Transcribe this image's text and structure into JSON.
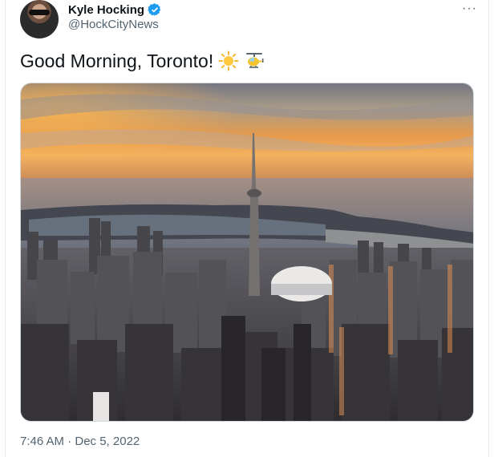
{
  "author": {
    "name": "Kyle Hocking",
    "handle": "@HockCityNews",
    "verified_icon": "verified-badge-icon"
  },
  "more_menu": {
    "label": "···",
    "icon": "more-icon"
  },
  "tweet": {
    "text": "Good Morning, Toronto!",
    "emojis": [
      "sun-icon",
      "helicopter-icon"
    ]
  },
  "media": {
    "icon": "photo-toronto-skyline-sunrise"
  },
  "footer": {
    "timestamp": "7:46 AM · Dec 5, 2022"
  },
  "colors": {
    "text": "#0f1419",
    "secondary": "#536471",
    "verified": "#1d9bf0",
    "border": "#cfd9de"
  }
}
